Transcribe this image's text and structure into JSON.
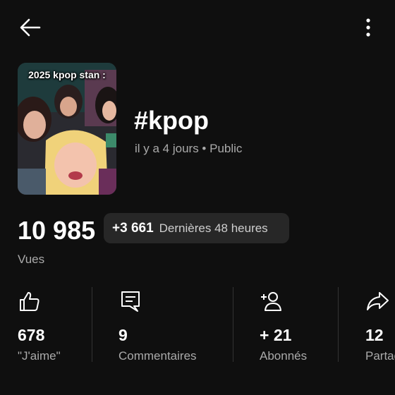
{
  "header": {
    "back_icon": "arrow-left-icon",
    "more_icon": "more-vertical-icon"
  },
  "short": {
    "thumbnail_caption": "2025 kpop stan :",
    "title": "#kpop",
    "meta": "il y a 4 jours • Public"
  },
  "views": {
    "value": "10 985",
    "label": "Vues",
    "delta_value": "+3 661",
    "delta_label": "Dernières 48 heures"
  },
  "stats": [
    {
      "icon": "thumbs-up-icon",
      "value": "678",
      "label": "\"J'aime\""
    },
    {
      "icon": "comment-icon",
      "value": "9",
      "label": "Commentaires"
    },
    {
      "icon": "add-subscriber-icon",
      "value": "+ 21",
      "label": "Abonnés"
    },
    {
      "icon": "share-icon",
      "value": "12",
      "label": "Partages"
    }
  ],
  "colors": {
    "background": "#0f0f0f",
    "pill": "#272727",
    "secondary_text": "#aaaaaa",
    "divider": "#333333"
  }
}
